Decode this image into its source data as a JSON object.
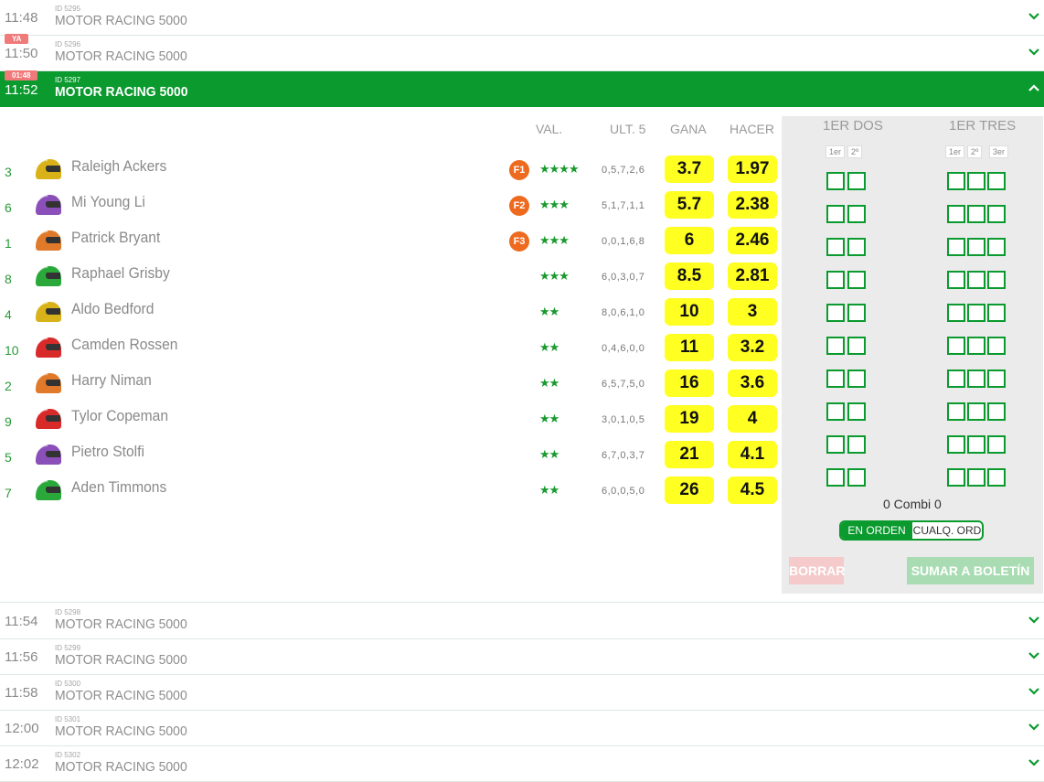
{
  "races_top": [
    {
      "time": "11:48",
      "id": "ID 5295",
      "name": "MOTOR RACING 5000",
      "badge": ""
    },
    {
      "time": "11:50",
      "id": "ID 5296",
      "name": "MOTOR RACING 5000",
      "badge": "YA"
    }
  ],
  "active_race": {
    "time": "11:52",
    "id": "ID 5297",
    "name": "MOTOR RACING 5000",
    "badge": "01:48"
  },
  "columns": {
    "val": "VAL.",
    "ult5": "ULT. 5",
    "gana": "GANA",
    "hacer": "HACER"
  },
  "runners": [
    {
      "num": "3",
      "name": "Raleigh Ackers",
      "helmet_color": "#d9b21a",
      "fav": "F1",
      "rating": 4,
      "stars": "★★★★",
      "ult5": "0,5,7,2,6",
      "gana": "3.7",
      "hacer": "1.97"
    },
    {
      "num": "6",
      "name": "Mi Young Li",
      "helmet_color": "#8a4fb8",
      "fav": "F2",
      "rating": 3.5,
      "stars": "★★★",
      "ult5": "5,1,7,1,1",
      "gana": "5.7",
      "hacer": "2.38"
    },
    {
      "num": "1",
      "name": "Patrick Bryant",
      "helmet_color": "#e07a2a",
      "fav": "F3",
      "rating": 3,
      "stars": "★★★",
      "ult5": "0,0,1,6,8",
      "gana": "6",
      "hacer": "2.46"
    },
    {
      "num": "8",
      "name": "Raphael Grisby",
      "helmet_color": "#2aa83a",
      "fav": "",
      "rating": 3,
      "stars": "★★★",
      "ult5": "6,0,3,0,7",
      "gana": "8.5",
      "hacer": "2.81"
    },
    {
      "num": "4",
      "name": "Aldo Bedford",
      "helmet_color": "#d9b21a",
      "fav": "",
      "rating": 2.5,
      "stars": "★★",
      "ult5": "8,0,6,1,0",
      "gana": "10",
      "hacer": "3"
    },
    {
      "num": "10",
      "name": "Camden Rossen",
      "helmet_color": "#d92a2a",
      "fav": "",
      "rating": 2.5,
      "stars": "★★",
      "ult5": "0,4,6,0,0",
      "gana": "11",
      "hacer": "3.2"
    },
    {
      "num": "2",
      "name": "Harry Niman",
      "helmet_color": "#e07a2a",
      "fav": "",
      "rating": 2,
      "stars": "★★",
      "ult5": "6,5,7,5,0",
      "gana": "16",
      "hacer": "3.6"
    },
    {
      "num": "9",
      "name": "Tylor Copeman",
      "helmet_color": "#d92a2a",
      "fav": "",
      "rating": 2.5,
      "stars": "★★",
      "ult5": "3,0,1,0,5",
      "gana": "19",
      "hacer": "4"
    },
    {
      "num": "5",
      "name": "Pietro Stolfi",
      "helmet_color": "#8a4fb8",
      "fav": "",
      "rating": 2,
      "stars": "★★",
      "ult5": "6,7,0,3,7",
      "gana": "21",
      "hacer": "4.1"
    },
    {
      "num": "7",
      "name": "Aden Timmons",
      "helmet_color": "#2aa83a",
      "fav": "",
      "rating": 2,
      "stars": "★★",
      "ult5": "6,0,0,5,0",
      "gana": "26",
      "hacer": "4.5"
    }
  ],
  "side": {
    "dos_title": "1ER DOS",
    "tres_title": "1ER TRES",
    "pos1": "1er",
    "pos2": "2º",
    "pos3": "3er",
    "combi": "0 Combi 0",
    "toggle_on": "EN ORDEN",
    "toggle_off": "CUALQ. ORD",
    "borrar": "BORRAR",
    "sumar": "SUMAR A BOLETÍN"
  },
  "races_bottom": [
    {
      "time": "11:54",
      "id": "ID 5298",
      "name": "MOTOR RACING 5000"
    },
    {
      "time": "11:56",
      "id": "ID 5299",
      "name": "MOTOR RACING 5000"
    },
    {
      "time": "11:58",
      "id": "ID 5300",
      "name": "MOTOR RACING 5000"
    },
    {
      "time": "12:00",
      "id": "ID 5301",
      "name": "MOTOR RACING 5000"
    },
    {
      "time": "12:02",
      "id": "ID 5302",
      "name": "MOTOR RACING 5000"
    }
  ],
  "colors": {
    "accent": "#0a9a2e",
    "odds_bg": "#ffff22",
    "fav_badge": "#ee6a1f"
  }
}
